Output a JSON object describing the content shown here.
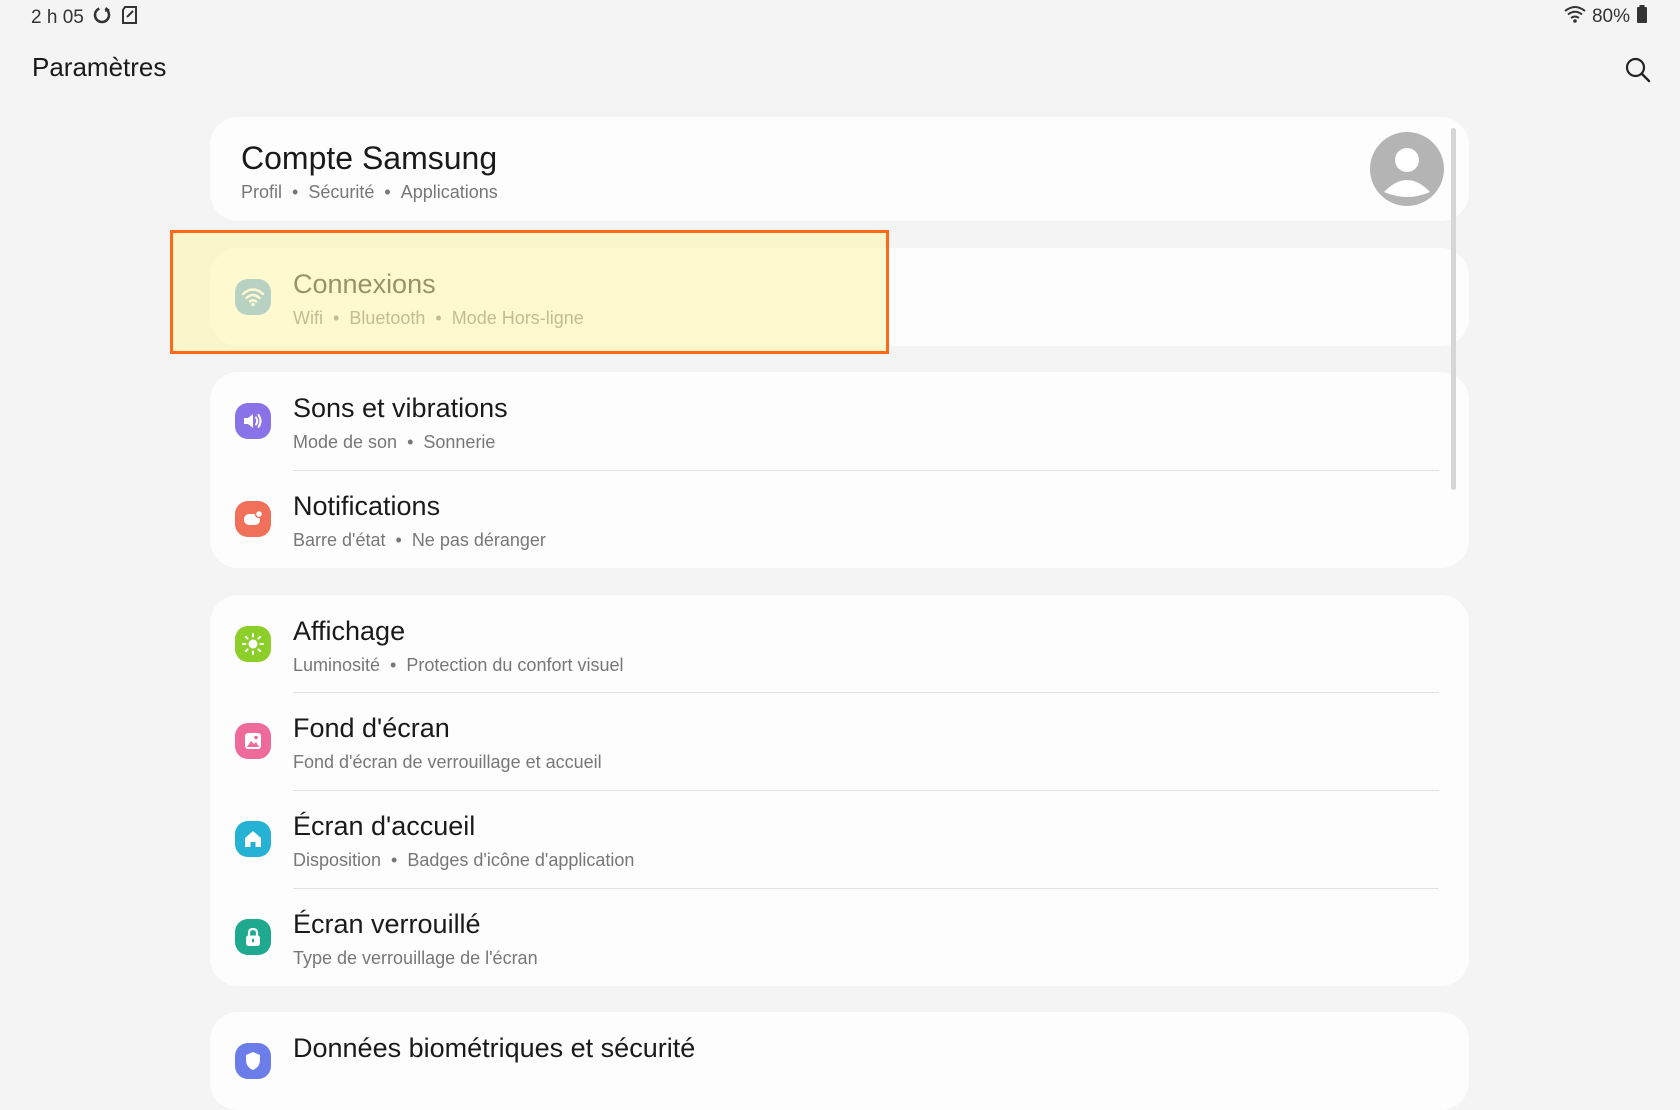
{
  "status_bar": {
    "time": "2 h 05",
    "battery": "80%",
    "icons": [
      "sync-icon",
      "sd-card-icon",
      "wifi-icon",
      "battery-icon"
    ]
  },
  "app_bar": {
    "title": "Paramètres",
    "search_icon": "search-icon"
  },
  "account": {
    "title": "Compte Samsung",
    "subtitle": [
      "Profil",
      "Sécurité",
      "Applications"
    ],
    "avatar_icon": "person-icon"
  },
  "groups": [
    {
      "items": [
        {
          "title": "Connexions",
          "subtitle": [
            "Wifi",
            "Bluetooth",
            "Mode Hors-ligne"
          ],
          "icon": "wifi-icon",
          "color": "#5fa7e0"
        }
      ]
    },
    {
      "items": [
        {
          "title": "Sons et vibrations",
          "subtitle": [
            "Mode de son",
            "Sonnerie"
          ],
          "icon": "speaker-icon",
          "color": "#8a73e8"
        },
        {
          "title": "Notifications",
          "subtitle": [
            "Barre d'état",
            "Ne pas déranger"
          ],
          "icon": "notification-icon",
          "color": "#f0705a"
        }
      ]
    },
    {
      "items": [
        {
          "title": "Affichage",
          "subtitle": [
            "Luminosité",
            "Protection du confort visuel"
          ],
          "icon": "brightness-icon",
          "color": "#8ccf2b"
        },
        {
          "title": "Fond d'écran",
          "subtitle": [
            "Fond d'écran de verrouillage et accueil"
          ],
          "icon": "wallpaper-icon",
          "color": "#ee6a9b"
        },
        {
          "title": "Écran d'accueil",
          "subtitle": [
            "Disposition",
            "Badges d'icône d'application"
          ],
          "icon": "home-icon",
          "color": "#25b2d4"
        },
        {
          "title": "Écran verrouillé",
          "subtitle": [
            "Type de verrouillage de l'écran"
          ],
          "icon": "lock-icon",
          "color": "#1fa98e"
        }
      ]
    },
    {
      "items": [
        {
          "title": "Données biométriques et sécurité",
          "subtitle": [],
          "icon": "shield-icon",
          "color": "#6a7de8"
        }
      ]
    }
  ],
  "highlight_color": "#ff6a1a"
}
